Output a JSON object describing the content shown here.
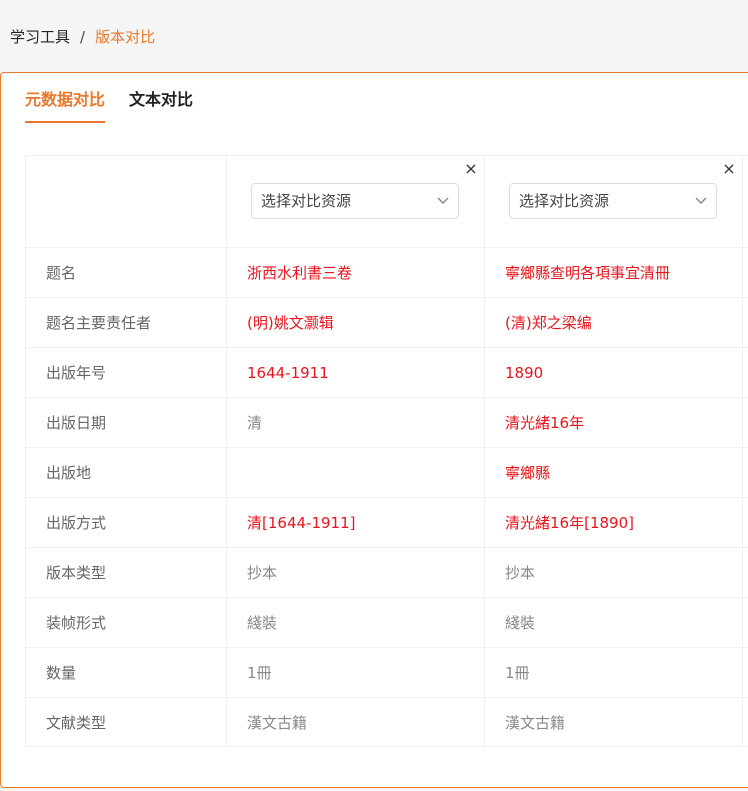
{
  "breadcrumb": {
    "root": "学习工具",
    "separator": "/",
    "current": "版本对比"
  },
  "tabs": [
    {
      "label": "元数据对比",
      "active": true
    },
    {
      "label": "文本对比",
      "active": false
    }
  ],
  "columns": [
    {
      "select_placeholder": "选择对比资源",
      "close_glyph": "×"
    },
    {
      "select_placeholder": "选择对比资源",
      "close_glyph": "×"
    }
  ],
  "rows": [
    {
      "label": "题名",
      "a": "浙西水利書三卷",
      "b": "寧鄉縣查明各項事宜清冊"
    },
    {
      "label": "题名主要责任者",
      "a": "(明)姚文灏辑",
      "b": "(清)郑之梁编"
    },
    {
      "label": "出版年号",
      "a": "1644-1911",
      "b": "1890"
    },
    {
      "label": "出版日期",
      "a": "清",
      "b": "清光緒16年"
    },
    {
      "label": "出版地",
      "a": "",
      "b": "寧鄉縣"
    },
    {
      "label": "出版方式",
      "a": "清[1644-1911]",
      "b": "清光緒16年[1890]"
    },
    {
      "label": "版本类型",
      "a": "抄本",
      "b": "抄本"
    },
    {
      "label": "装帧形式",
      "a": "綫裝",
      "b": "綫裝"
    },
    {
      "label": "数量",
      "a": "1冊",
      "b": "1冊"
    },
    {
      "label": "文献类型",
      "a": "漢文古籍",
      "b": "漢文古籍"
    }
  ],
  "colors": {
    "accent": "#e8792c",
    "diff": "#e8141e",
    "highlight": "#ffe600"
  }
}
